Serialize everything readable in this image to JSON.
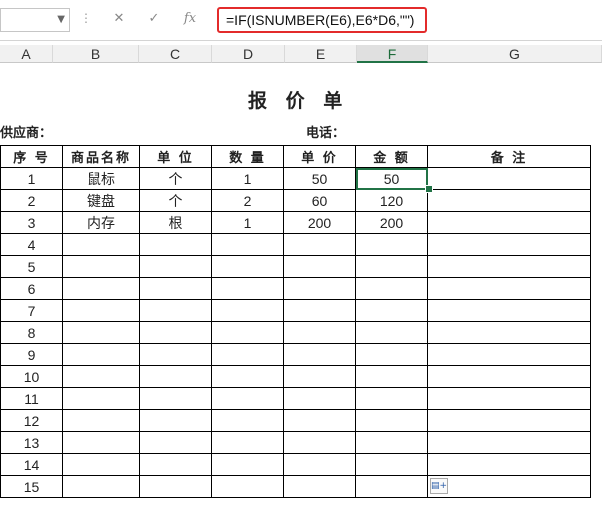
{
  "formula_bar": {
    "name_box_value": "",
    "cancel_icon": "x-icon",
    "enter_icon": "check-icon",
    "fx_label": "fx",
    "formula": "=IF(ISNUMBER(E6),E6*D6,\"\")"
  },
  "columns": [
    "A",
    "B",
    "C",
    "D",
    "E",
    "F",
    "G"
  ],
  "active_column": "F",
  "sheet": {
    "title": "报 价 单",
    "supplier_label": "供应商：",
    "phone_label": "电话：",
    "headers": [
      "序 号",
      "商品名称",
      "单 位",
      "数 量",
      "单 价",
      "金 额",
      "备 注"
    ],
    "rows": [
      [
        "1",
        "鼠标",
        "个",
        "1",
        "50",
        "50",
        ""
      ],
      [
        "2",
        "键盘",
        "个",
        "2",
        "60",
        "120",
        ""
      ],
      [
        "3",
        "内存",
        "根",
        "1",
        "200",
        "200",
        ""
      ],
      [
        "4",
        "",
        "",
        "",
        "",
        "",
        ""
      ],
      [
        "5",
        "",
        "",
        "",
        "",
        "",
        ""
      ],
      [
        "6",
        "",
        "",
        "",
        "",
        "",
        ""
      ],
      [
        "7",
        "",
        "",
        "",
        "",
        "",
        ""
      ],
      [
        "8",
        "",
        "",
        "",
        "",
        "",
        ""
      ],
      [
        "9",
        "",
        "",
        "",
        "",
        "",
        ""
      ],
      [
        "10",
        "",
        "",
        "",
        "",
        "",
        ""
      ],
      [
        "11",
        "",
        "",
        "",
        "",
        "",
        ""
      ],
      [
        "12",
        "",
        "",
        "",
        "",
        "",
        ""
      ],
      [
        "13",
        "",
        "",
        "",
        "",
        "",
        ""
      ],
      [
        "14",
        "",
        "",
        "",
        "",
        "",
        ""
      ],
      [
        "15",
        "",
        "",
        "",
        "",
        "",
        ""
      ]
    ]
  },
  "selected_cell": "F6"
}
